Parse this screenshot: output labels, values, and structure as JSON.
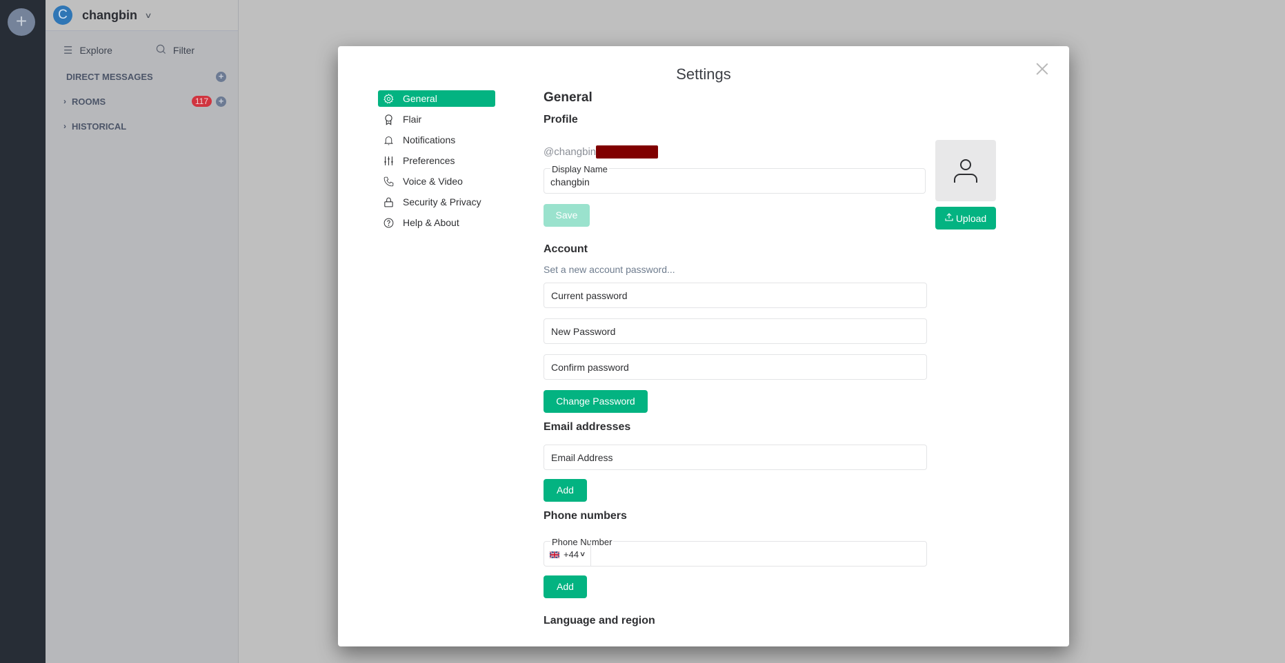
{
  "rail": {
    "add_icon": "+"
  },
  "panel": {
    "user_initial": "C",
    "username": "changbin",
    "explore_label": "Explore",
    "filter_label": "Filter",
    "sections": [
      {
        "label": "DIRECT MESSAGES"
      },
      {
        "label": "ROOMS",
        "badge": "117"
      },
      {
        "label": "HISTORICAL"
      }
    ]
  },
  "modal": {
    "title": "Settings",
    "nav": [
      {
        "label": "General",
        "icon": "gear-icon",
        "active": true
      },
      {
        "label": "Flair",
        "icon": "ribbon-icon"
      },
      {
        "label": "Notifications",
        "icon": "bell-icon"
      },
      {
        "label": "Preferences",
        "icon": "sliders-icon"
      },
      {
        "label": "Voice & Video",
        "icon": "phone-icon"
      },
      {
        "label": "Security & Privacy",
        "icon": "lock-icon"
      },
      {
        "label": "Help & About",
        "icon": "help-circle-icon"
      }
    ],
    "general": {
      "heading": "General",
      "profile": {
        "heading": "Profile",
        "mxid_prefix": "@changbin",
        "display_name_label": "Display Name",
        "display_name_value": "changbin",
        "save_label": "Save",
        "upload_label": "Upload"
      },
      "account": {
        "heading": "Account",
        "hint": "Set a new account password...",
        "current_password_placeholder": "Current password",
        "new_password_placeholder": "New Password",
        "confirm_password_placeholder": "Confirm password",
        "change_label": "Change Password"
      },
      "email": {
        "heading": "Email addresses",
        "placeholder": "Email Address",
        "add_label": "Add"
      },
      "phone": {
        "heading": "Phone numbers",
        "label": "Phone Number",
        "country_code": "+44",
        "add_label": "Add"
      },
      "language": {
        "heading": "Language and region"
      }
    }
  },
  "colors": {
    "accent": "#03b381",
    "badge": "#d0343f",
    "redaction": "#800000"
  }
}
